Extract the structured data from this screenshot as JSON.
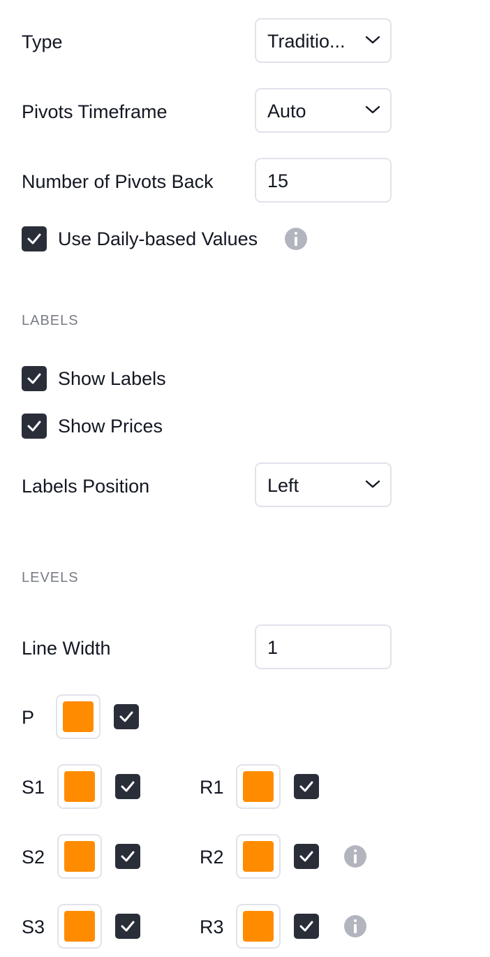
{
  "settings": {
    "type": {
      "label": "Type",
      "value": "Traditio..."
    },
    "timeframe": {
      "label": "Pivots Timeframe",
      "value": "Auto"
    },
    "pivots_back": {
      "label": "Number of Pivots Back",
      "value": "15"
    },
    "daily_based": {
      "label": "Use Daily-based Values",
      "checked": true
    }
  },
  "labels_section": {
    "heading": "LABELS",
    "show_labels": {
      "label": "Show Labels",
      "checked": true
    },
    "show_prices": {
      "label": "Show Prices",
      "checked": true
    },
    "position": {
      "label": "Labels Position",
      "value": "Left"
    }
  },
  "levels_section": {
    "heading": "LEVELS",
    "line_width": {
      "label": "Line Width",
      "value": "1"
    },
    "levels": [
      {
        "name": "P",
        "color": "#FF8C00",
        "checked": true
      },
      {
        "name": "S1",
        "color": "#FF8C00",
        "checked": true
      },
      {
        "name": "R1",
        "color": "#FF8C00",
        "checked": true
      },
      {
        "name": "S2",
        "color": "#FF8C00",
        "checked": true
      },
      {
        "name": "R2",
        "color": "#FF8C00",
        "checked": true
      },
      {
        "name": "S3",
        "color": "#FF8C00",
        "checked": true
      },
      {
        "name": "R3",
        "color": "#FF8C00",
        "checked": true
      }
    ]
  },
  "icons": {
    "chevron": "chevron-down-icon",
    "check": "checkmark-icon",
    "info": "info-icon"
  },
  "colors": {
    "checkbox": "#2A2E39",
    "border": "#E0E3EB",
    "muted": "#787B86",
    "info": "#B2B5BE",
    "swatch": "#FF8C00"
  }
}
